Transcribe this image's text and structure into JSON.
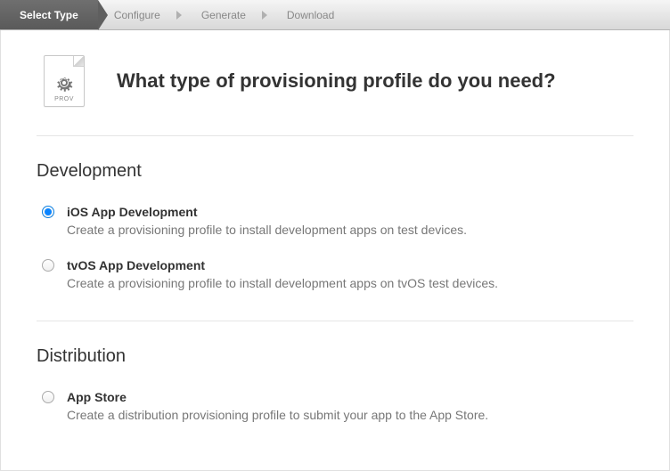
{
  "breadcrumb": {
    "items": [
      {
        "label": "Select Type",
        "active": true
      },
      {
        "label": "Configure",
        "active": false
      },
      {
        "label": "Generate",
        "active": false
      },
      {
        "label": "Download",
        "active": false
      }
    ]
  },
  "header": {
    "icon_label": "PROV",
    "title": "What type of provisioning profile do you need?"
  },
  "sections": [
    {
      "title": "Development",
      "options": [
        {
          "label": "iOS App Development",
          "desc": "Create a provisioning profile to install development apps on test devices.",
          "checked": true
        },
        {
          "label": "tvOS App Development",
          "desc": "Create a provisioning profile to install development apps on tvOS test devices.",
          "checked": false
        }
      ]
    },
    {
      "title": "Distribution",
      "options": [
        {
          "label": "App Store",
          "desc": "Create a distribution provisioning profile to submit your app to the App Store.",
          "checked": false
        }
      ]
    }
  ]
}
